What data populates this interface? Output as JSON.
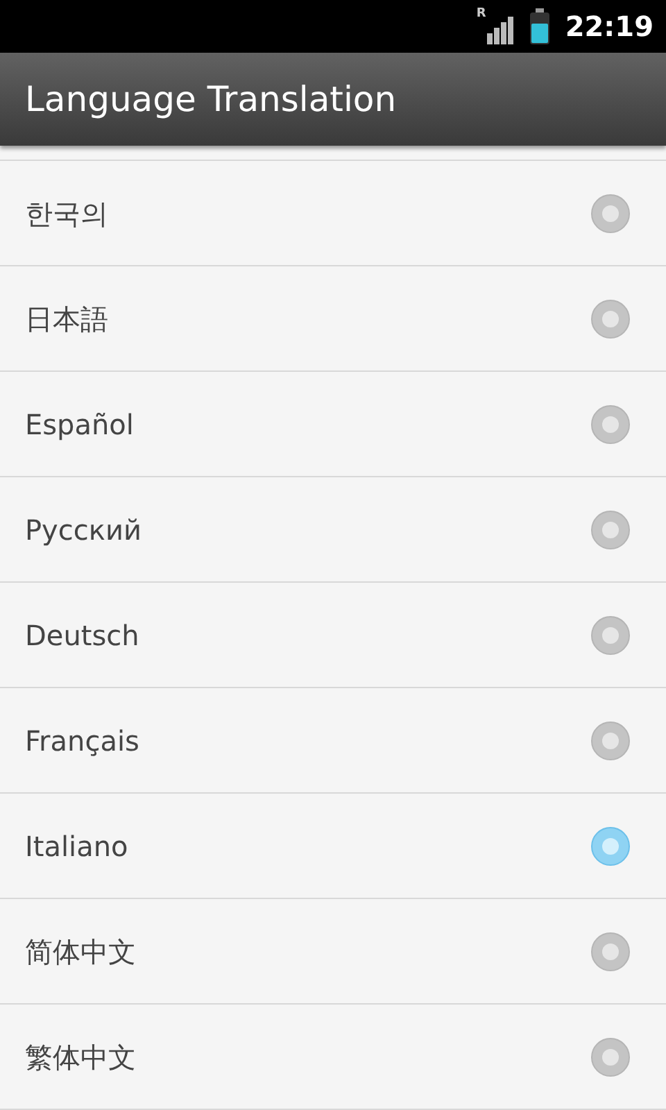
{
  "status_bar": {
    "roaming": "R",
    "time": "22:19"
  },
  "title": "Language Translation",
  "languages": [
    {
      "label": "한국의",
      "selected": false
    },
    {
      "label": "日本語",
      "selected": false
    },
    {
      "label": "Español",
      "selected": false
    },
    {
      "label": "Русский",
      "selected": false
    },
    {
      "label": "Deutsch",
      "selected": false
    },
    {
      "label": "Français",
      "selected": false
    },
    {
      "label": "Italiano",
      "selected": true
    },
    {
      "label": "简体中文",
      "selected": false
    },
    {
      "label": "繁体中文",
      "selected": false
    }
  ]
}
